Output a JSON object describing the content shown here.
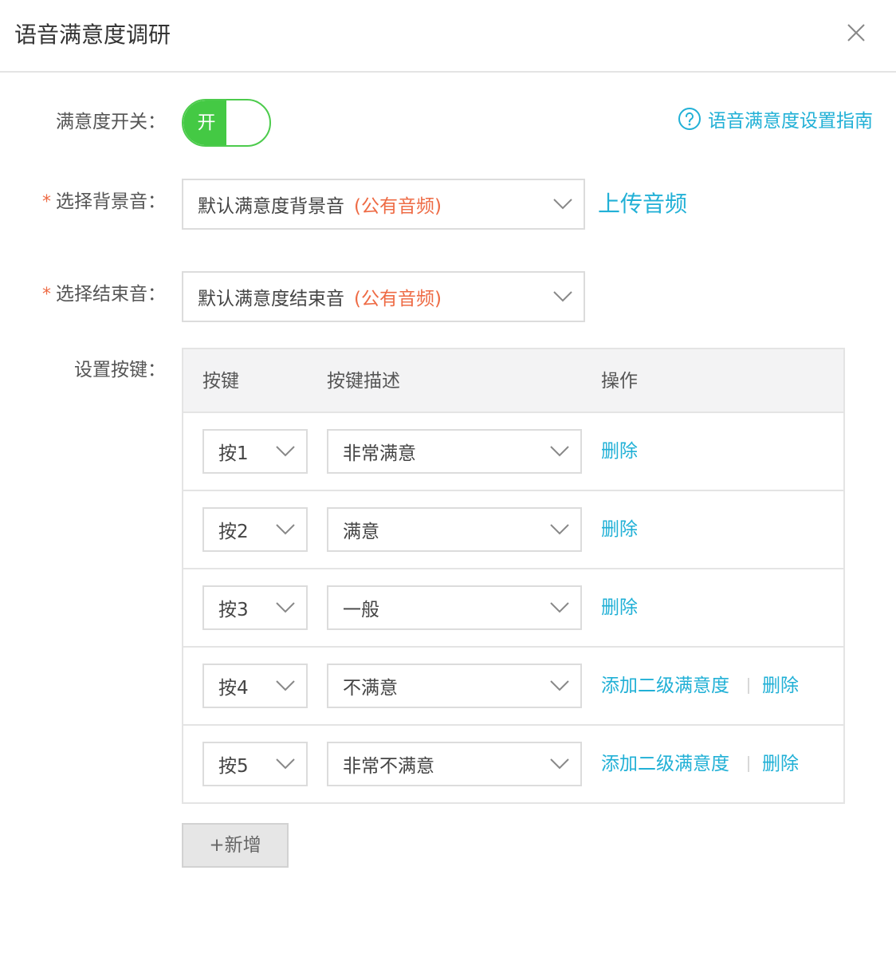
{
  "dialog": {
    "title": "语音满意度调研"
  },
  "form": {
    "switch_label": "满意度开关：",
    "switch_on_text": "开",
    "guide_link": "语音满意度设置指南",
    "bg_label": "选择背景音：",
    "bg_value": "默认满意度背景音",
    "bg_tag": "(公有音频)",
    "upload_link": "上传音频",
    "end_label": "选择结束音：",
    "end_value": "默认满意度结束音",
    "end_tag": "(公有音频)",
    "keys_label": "设置按键：",
    "required_mark": "*"
  },
  "table": {
    "headers": {
      "key": "按键",
      "desc": "按键描述",
      "action": "操作"
    },
    "rows": [
      {
        "key": "按1",
        "desc": "非常满意",
        "delete": "删除"
      },
      {
        "key": "按2",
        "desc": "满意",
        "delete": "删除"
      },
      {
        "key": "按3",
        "desc": "一般",
        "delete": "删除"
      },
      {
        "key": "按4",
        "desc": "不满意",
        "add_second": "添加二级满意度",
        "delete": "删除"
      },
      {
        "key": "按5",
        "desc": "非常不满意",
        "add_second": "添加二级满意度",
        "delete": "删除"
      }
    ]
  },
  "add_button": "+新增",
  "colors": {
    "accent": "#21b0d6",
    "toggle_green": "#44c944",
    "tag_orange": "#ee6b45"
  }
}
